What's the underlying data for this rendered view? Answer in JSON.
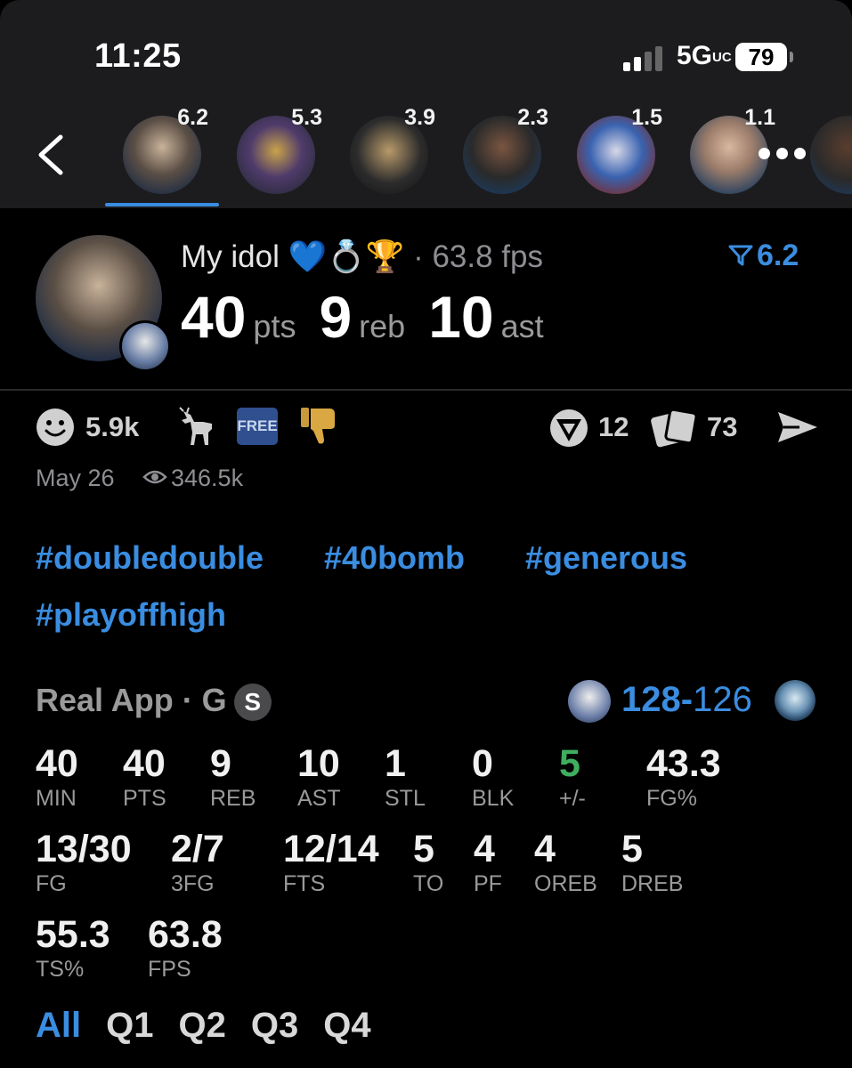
{
  "status_bar": {
    "time": "11:25",
    "network": "5G",
    "network_suffix": "UC",
    "battery": "79"
  },
  "stories": [
    {
      "score": "6.2",
      "active": true
    },
    {
      "score": "5.3"
    },
    {
      "score": "3.9"
    },
    {
      "score": "2.3"
    },
    {
      "score": "1.5"
    },
    {
      "score": "1.1"
    }
  ],
  "post": {
    "title": "My idol 💙💍🏆",
    "fps_inline": "· 63.8 fps",
    "score": "6.2",
    "pts": "40",
    "pts_label": "pts",
    "reb": "9",
    "reb_label": "reb",
    "ast": "10",
    "ast_label": "ast"
  },
  "reactions": {
    "smile_count": "5.9k",
    "free_label": "FREE",
    "comments_count": "12",
    "cards_count": "73"
  },
  "meta": {
    "date": "May 26",
    "views": "346.5k"
  },
  "hashtags": [
    "#doubledouble",
    "#40bomb",
    "#generous",
    "#playoffhigh"
  ],
  "game": {
    "source": "Real App · G",
    "badge": "S",
    "score_win": "128",
    "score_sep": "-",
    "score_lose": "126"
  },
  "stats": [
    {
      "value": "40",
      "label": "MIN"
    },
    {
      "value": "40",
      "label": "PTS"
    },
    {
      "value": "9",
      "label": "REB"
    },
    {
      "value": "10",
      "label": "AST"
    },
    {
      "value": "1",
      "label": "STL"
    },
    {
      "value": "0",
      "label": "BLK"
    },
    {
      "value": "5",
      "label": "+/-"
    },
    {
      "value": "43.3",
      "label": "FG%"
    },
    {
      "value": "13/30",
      "label": "FG"
    },
    {
      "value": "2/7",
      "label": "3FG"
    },
    {
      "value": "12/14",
      "label": "FTS"
    },
    {
      "value": "5",
      "label": "TO"
    },
    {
      "value": "4",
      "label": "PF"
    },
    {
      "value": "4",
      "label": "OREB"
    },
    {
      "value": "5",
      "label": "DREB"
    },
    {
      "value": "55.3",
      "label": "TS%"
    },
    {
      "value": "63.8",
      "label": "FPS"
    }
  ],
  "tabs": [
    "All",
    "Q1",
    "Q2",
    "Q3",
    "Q4"
  ],
  "colors": {
    "accent": "#3a8de0",
    "positive": "#3fae5f",
    "background": "#000000",
    "topbar": "#1c1c1e"
  }
}
